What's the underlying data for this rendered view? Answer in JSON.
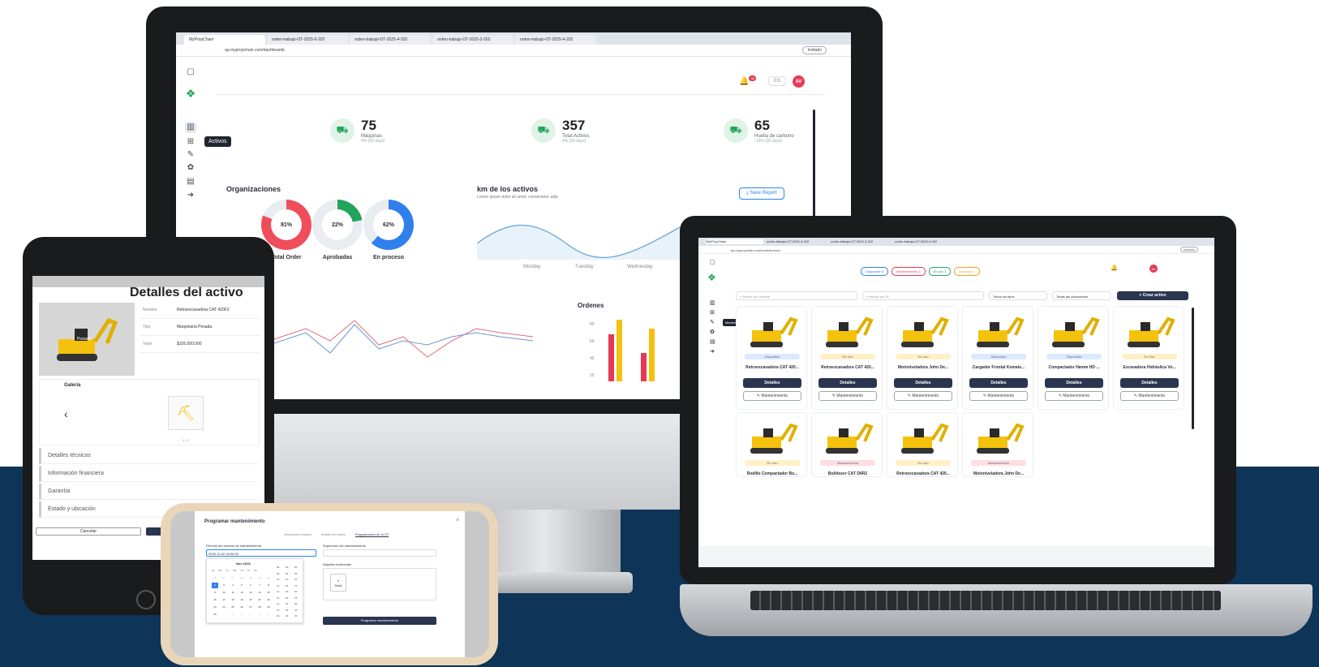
{
  "colors": {
    "band": "#0e3458",
    "accent": "#e63956",
    "green": "#22a45a",
    "blue": "#2f80ed",
    "navy": "#2a3550",
    "yellow": "#f4c20d"
  },
  "monitor": {
    "tabs": [
      "MyPropChain",
      "orden-trabajo-OT-2025-6-202",
      "orden-trabajo-OT-2025-4-202",
      "orden-trabajo-OT-2025-3-202",
      "orden-trabajo-OT-2025-4-202"
    ],
    "url": "qa.mypropchain.com/dashboards",
    "invited": "Invitado",
    "notif_count": "38",
    "lang": "ES",
    "avatar": "AV",
    "tooltip": "Activos",
    "stats": [
      {
        "value": "75",
        "label": "Máquinas",
        "sub": "4% (30 days)"
      },
      {
        "value": "357",
        "label": "Total Activos",
        "sub": "4% (30 days)"
      },
      {
        "value": "65",
        "label": "Huella de carbono",
        "sub": "-10% (30 days)"
      }
    ],
    "org_title": "Organizaciones",
    "donuts": [
      {
        "label": "Total Order",
        "pct": "81%",
        "value": 81,
        "color": "#ef4d5a"
      },
      {
        "label": "Aprobadas",
        "pct": "22%",
        "value": 22,
        "color": "#22a45a"
      },
      {
        "label": "En proceso",
        "pct": "62%",
        "value": 62,
        "color": "#2f80ed"
      }
    ],
    "km_title": "km de los activos",
    "km_sub": "Lorem ipsum dolor sit amet, consectetur adip",
    "save_report": "Save Report",
    "days": [
      "Monday",
      "Tuesday",
      "Wednesday"
    ],
    "ordenes_title": "Ordenes",
    "ordenes_ticks": [
      "80",
      "60",
      "40",
      "20"
    ]
  },
  "tablet": {
    "title": "Detalles del activo",
    "fields": [
      {
        "k": "Nombre",
        "v": "Retroexcavadora CAT 420F2"
      },
      {
        "k": "Tipo",
        "v": "Maquinaria Pesada"
      },
      {
        "k": "Valor",
        "v": "$105,000.000"
      }
    ],
    "gallery": "Galería",
    "gallery_count": "1 / 1",
    "badge": "Portada",
    "sections": [
      "Detalles técnicos",
      "Información financiera",
      "Garantía",
      "Estado y ubicación"
    ],
    "cancel": "Cancelar"
  },
  "phone": {
    "title": "Programar mantenimiento",
    "steps": [
      "Información básica",
      "Detalle del activo",
      "Programación de la OT"
    ],
    "period_label": "Período del servicio de mantenimiento",
    "period_value": "2025-11-02 16:00:00",
    "supervisor_label": "Supervisor del mantenimiento",
    "evidence_label": "Adjuntar evidencias",
    "upload": "Subir",
    "month": "Nov 2025",
    "weekdays": [
      "Su",
      "Mo",
      "Tu",
      "We",
      "Th",
      "Fr",
      "Sa"
    ],
    "submit": "Programar mantenimiento"
  },
  "laptop": {
    "tabs": [
      "MyPropChain",
      "orden-trabajo-OT-2025-4-202",
      "orden-trabajo-OT-2025-3-202",
      "orden-trabajo-OT-2025-4-202"
    ],
    "url": "qa.mypropchain.com/maintenance",
    "invited": "Invitado",
    "filters": [
      {
        "label": "Disponible 5",
        "color": "#2f80ed"
      },
      {
        "label": "Mantenimiento 2",
        "color": "#e63956"
      },
      {
        "label": "En uso 3",
        "color": "#22a45a"
      },
      {
        "label": "Inactivos 0",
        "color": "#f0a020"
      }
    ],
    "search_name": "Buscar por nombre",
    "search_id": "Buscar por ID",
    "types": "Todos los tipos",
    "locations": "Todas las ubicaciones",
    "create": "+ Crear activo",
    "tooltip": "Mantenimiento",
    "details": "Detalles",
    "maint": "Mantenimiento",
    "cards": [
      {
        "name": "Retroexcavadora CAT 420...",
        "status": "Disponible",
        "sc": "#dbe9ff"
      },
      {
        "name": "Retroexcavadora CAT 420...",
        "status": "En Uso",
        "sc": "#fff1c6"
      },
      {
        "name": "Motoniveladora John De...",
        "status": "En Uso",
        "sc": "#fff1c6"
      },
      {
        "name": "Cargador Frontal Komats...",
        "status": "Disponible",
        "sc": "#dbe9ff"
      },
      {
        "name": "Compactador Hamm HD ...",
        "status": "Disponible",
        "sc": "#dbe9ff"
      },
      {
        "name": "Excavadora Hidráulica Vo...",
        "status": "En Uso",
        "sc": "#fff1c6"
      },
      {
        "name": "Rodillo Compactador Bo...",
        "status": "En Uso",
        "sc": "#fff1c6"
      },
      {
        "name": "Bulldozer CAT D6R2",
        "status": "Mantenimiento",
        "sc": "#ffdde3"
      },
      {
        "name": "Retroexcavadora CAT 420...",
        "status": "En Uso",
        "sc": "#fff1c6"
      },
      {
        "name": "Motoniveladora John De...",
        "status": "Mantenimiento",
        "sc": "#ffdde3"
      }
    ]
  }
}
